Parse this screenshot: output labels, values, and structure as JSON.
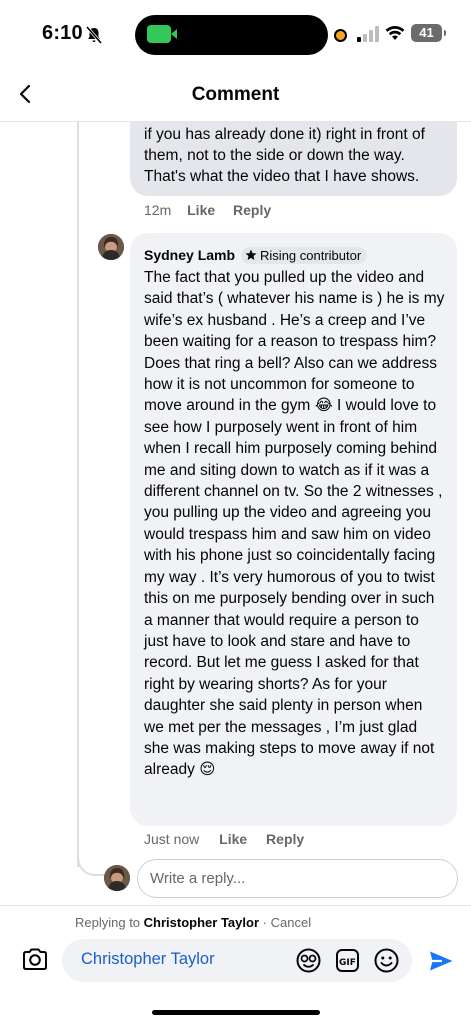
{
  "status": {
    "time": "6:10",
    "battery": "41"
  },
  "header": {
    "title": "Comment"
  },
  "previous_comment": {
    "text": "if you has already done it) right in front of them, not to the side or down the way. That's what the video that I have shows.",
    "time": "12m",
    "like_label": "Like",
    "reply_label": "Reply"
  },
  "comment": {
    "author": "Sydney Lamb",
    "badge": "Rising contributor",
    "text": "The fact that you pulled up the video and said that’s ( whatever his name is ) he is my wife’s ex husband . He’s a creep and I’ve been waiting for a reason to trespass him? Does that ring a bell? Also can we address how it is not uncommon for someone to move around in the gym 😂 I would love to see how I purposely went in front of him when I recall him purposely coming behind me and siting down to watch as if it was a different channel on tv. So the 2 witnesses , you pulling up the video and agreeing you would trespass him and saw him on video with his phone just so coincidentally facing my way . It’s very humorous of you to twist this on me purposely bending over in such a manner that would require a person to just have to look and stare and have to record. But let me guess I asked for that right by wearing shorts? As for your daughter she said plenty in person when we met per the messages , I’m just glad she was making steps to move away if not already 😌",
    "time": "Just now",
    "like_label": "Like",
    "reply_label": "Reply"
  },
  "reply_input": {
    "placeholder": "Write a reply..."
  },
  "replying_to": {
    "prefix": "Replying to",
    "name": "Christopher Taylor",
    "separator": "·",
    "cancel": "Cancel"
  },
  "composer": {
    "text": "Christopher Taylor"
  },
  "icons": {
    "back": "chevron-left-icon",
    "camera": "camera-icon",
    "sticker": "sticker-icon",
    "gif": "gif-icon",
    "emoji": "emoji-icon",
    "send": "send-icon"
  },
  "colors": {
    "accent": "#1877f2",
    "mention": "#1a5fc7",
    "bubble": "#f0f2f5",
    "bubble_prev": "#e4e6eb",
    "muted": "#65676b"
  }
}
